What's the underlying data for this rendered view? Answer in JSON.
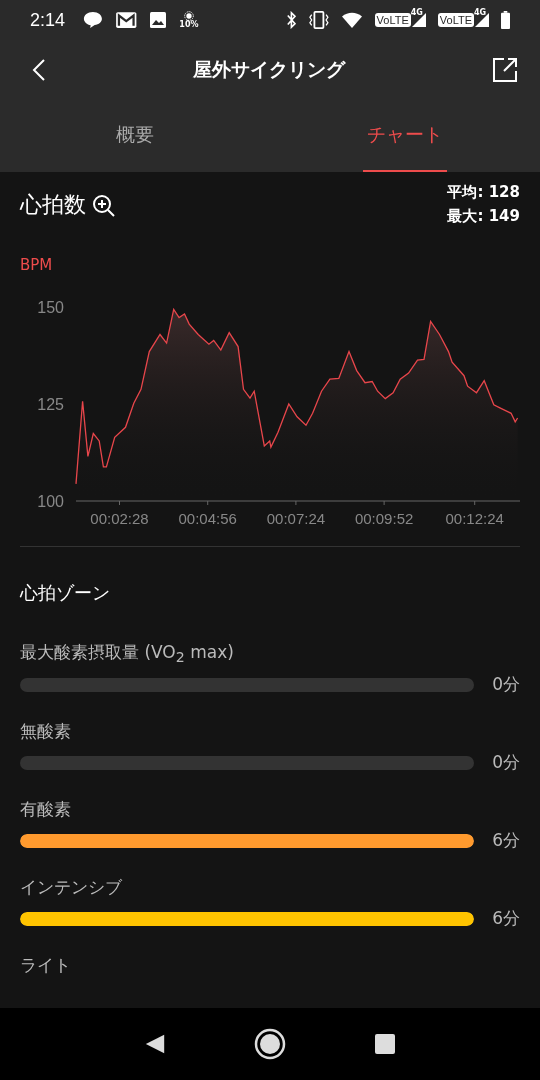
{
  "status_bar": {
    "time": "2:14",
    "brightness": "10%",
    "networks": [
      {
        "badge": "VoLTE",
        "gen": "4G"
      },
      {
        "badge": "VoLTE",
        "gen": "4G"
      }
    ]
  },
  "header": {
    "title": "屋外サイクリング"
  },
  "tabs": [
    {
      "label": "概要",
      "selected": false
    },
    {
      "label": "チャート",
      "selected": true
    }
  ],
  "heart_rate": {
    "title": "心拍数",
    "stats": [
      "平均: 128",
      "最大: 149"
    ],
    "unit": "BPM",
    "chart_data": {
      "type": "area",
      "xlim": [
        75,
        820
      ],
      "ylim": [
        100,
        150
      ],
      "yticks": [
        100,
        125,
        150
      ],
      "xticks": [
        {
          "value": 148,
          "label": "00:02:28"
        },
        {
          "value": 296,
          "label": "00:04:56"
        },
        {
          "value": 444,
          "label": "00:07:24"
        },
        {
          "value": 592,
          "label": "00:09:52"
        },
        {
          "value": 744,
          "label": "00:12:24"
        }
      ],
      "x": [
        75,
        86,
        95,
        104,
        114,
        121,
        126,
        140,
        158,
        172,
        184,
        198,
        216,
        227,
        239,
        248,
        257,
        265,
        280,
        298,
        306,
        318,
        332,
        347,
        356,
        367,
        374,
        391,
        400,
        402,
        414,
        432,
        446,
        461,
        472,
        487,
        501,
        516,
        533,
        546,
        560,
        572,
        581,
        594,
        607,
        619,
        633,
        648,
        659,
        670,
        685,
        700,
        706,
        726,
        732,
        747,
        760,
        776,
        788,
        805,
        812,
        816
      ],
      "series": [
        {
          "color": "#e8464b",
          "values": [
            104.4,
            125.7,
            111.5,
            117.4,
            115.5,
            108.8,
            108.8,
            116.4,
            119,
            125.2,
            128.8,
            138.5,
            142.9,
            140.7,
            149.4,
            147.3,
            148.2,
            145.6,
            142.9,
            140.4,
            141.4,
            138.9,
            143.4,
            139.8,
            128.8,
            126.5,
            128.3,
            114.2,
            115.5,
            113.9,
            117.7,
            125,
            121.7,
            119.5,
            122.6,
            128.3,
            131.4,
            131.6,
            138.5,
            133.6,
            130.5,
            130.8,
            128.3,
            126.4,
            127.9,
            131.4,
            133,
            136.3,
            136.5,
            146.3,
            142.9,
            138.5,
            135.8,
            132.3,
            129.6,
            127.9,
            131,
            124.8,
            123.9,
            122.6,
            120.4,
            121.4
          ]
        }
      ]
    }
  },
  "zones": {
    "title": "心拍ゾーン",
    "items": [
      {
        "label": "最大酸素摂取量 (VO$_{2}$ max)",
        "value": "0分"
      },
      {
        "label": "無酸素",
        "value": "0分"
      },
      {
        "label": "有酸素",
        "value": "6分",
        "level": 1,
        "color": "#ff9a2e"
      },
      {
        "label": "インテンシブ",
        "value": "6分",
        "level": 1,
        "color": "#ffc400"
      },
      {
        "label": "ライト"
      }
    ]
  }
}
